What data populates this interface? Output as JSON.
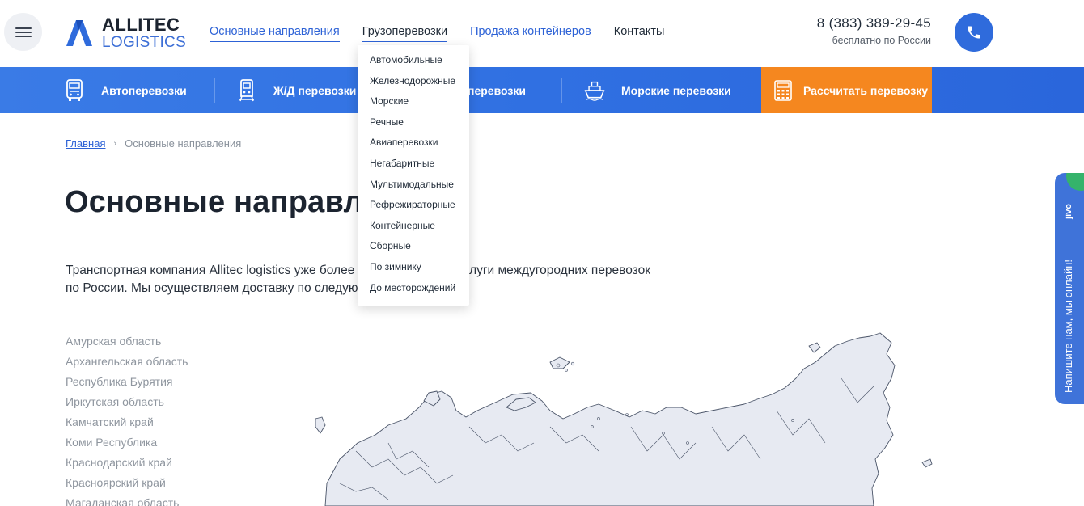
{
  "header": {
    "logo_line1": "ALLITEC",
    "logo_line2": "LOGISTICS",
    "nav": [
      "Основные направления",
      "Грузоперевозки",
      "Продажа контейнеров",
      "Контакты"
    ],
    "phone": "8 (383) 389-29-45",
    "phone_note": "бесплатно по России",
    "accent": "#2f6bdc"
  },
  "band": {
    "items": [
      "Автоперевозки",
      "Ж/Д перевозки",
      "перевозки",
      "Морские перевозки"
    ],
    "calc_label": "Рассчитать перевозку",
    "calc_color": "#f5871f"
  },
  "dropdown": {
    "items": [
      "Автомобильные",
      "Железнодорожные",
      "Морские",
      "Речные",
      "Авиаперевозки",
      "Негабаритные",
      "Мультимодальные",
      "Рефрежираторные",
      "Контейнерные",
      "Сборные",
      "По зимнику",
      "До месторождений"
    ]
  },
  "breadcrumb": {
    "home": "Главная",
    "current": "Основные направления"
  },
  "page_title": "Основные направлени",
  "intro": {
    "line1": "Транспортная компания Allitec logistics уже более",
    "line1_end": "слуги междугородних перевозок",
    "line2": "по России. Мы осуществляем доставку по следую"
  },
  "regions": [
    "Амурская область",
    "Архангельская область",
    "Республика Бурятия",
    "Иркутская область",
    "Камчатский край",
    "Коми Республика",
    "Краснодарский край",
    "Красноярский край",
    "Магаданская область"
  ],
  "jivo": {
    "brand": "jivo",
    "cta": "Напишите нам, мы онлайн!"
  }
}
